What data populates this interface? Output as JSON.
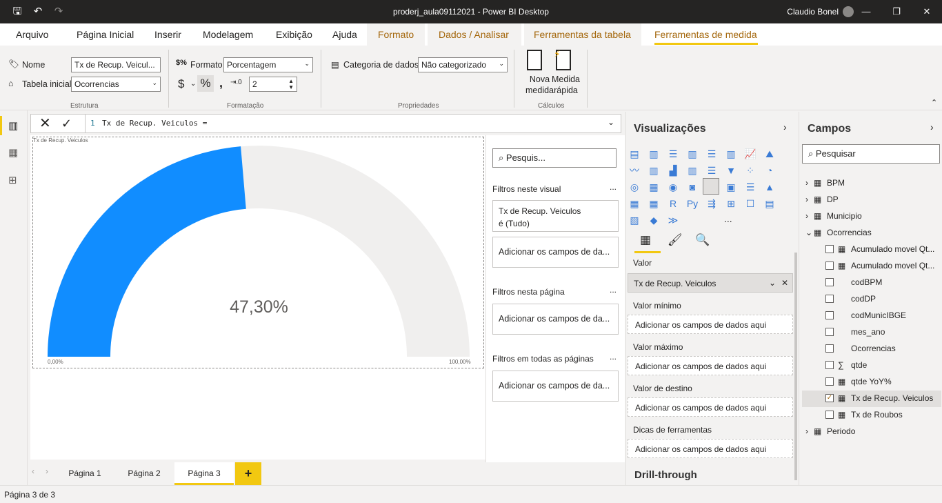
{
  "window": {
    "title": "proderj_aula09112021 - Power BI Desktop",
    "user": "Claudio Bonel"
  },
  "tabs": [
    "Arquivo",
    "Página Inicial",
    "Inserir",
    "Modelagem",
    "Exibição",
    "Ajuda",
    "Formato",
    "Dados / Analisar",
    "Ferramentas da tabela",
    "Ferramentas de medida"
  ],
  "ribbon": {
    "nome_label": "Nome",
    "nome_value": "Tx de Recup. Veicul...",
    "tabela_label": "Tabela inicial",
    "tabela_value": "Ocorrencias",
    "formato_label": "Formato",
    "formato_value": "Porcentagem",
    "currency": "$",
    "percent": "%",
    "comma": ",",
    "decimals": "2",
    "categoria_label": "Categoria de dados",
    "categoria_value": "Não categorizado",
    "nova_medida": [
      "Nova",
      "medida"
    ],
    "medida_rapida": [
      "Medida",
      "rápida"
    ],
    "groups": [
      "Estrutura",
      "Formatação",
      "Propriedades",
      "Cálculos"
    ]
  },
  "formula": {
    "line": "1",
    "text": "Tx de Recup. Veiculos ="
  },
  "visual": {
    "title": "Tx de Recup. Veiculos",
    "value_label": "47,30%",
    "min_label": "0,00%",
    "max_label": "100,00%"
  },
  "chart_data": {
    "type": "gauge",
    "value": 47.3,
    "min": 0,
    "max": 100,
    "unit": "%",
    "fill_color": "#118dff",
    "track_color": "#f0efee"
  },
  "filters": {
    "search": "Pesquis...",
    "visual_hdr": "Filtros neste visual",
    "applied": [
      "Tx de Recup. Veiculos",
      "é (Tudo)"
    ],
    "add": "Adicionar os campos de da...",
    "page_hdr": "Filtros nesta página",
    "all_hdr": "Filtros em todas as páginas",
    "dots": "..."
  },
  "viz": {
    "title": "Visualizações",
    "valor": "Valor",
    "valor_field": "Tx de Recup. Veiculos",
    "wells": [
      "Valor mínimo",
      "Valor máximo",
      "Valor de destino",
      "Dicas de ferramentas"
    ],
    "add": "Adicionar os campos de dados aqui",
    "drill": "Drill-through",
    "more": "..."
  },
  "campos": {
    "title": "Campos",
    "search": "Pesquisar",
    "tables": [
      "BPM",
      "DP",
      "Municipio",
      "Ocorrencias",
      "Periodo"
    ],
    "fields": [
      "Acumulado movel Qt...",
      "Acumulado movel Qt...",
      "codBPM",
      "codDP",
      "codMunicIBGE",
      "mes_ano",
      "Ocorrencias",
      "qtde",
      "qtde YoY%",
      "Tx de Recup. Veiculos",
      "Tx de Roubos"
    ]
  },
  "pages": [
    "Página 1",
    "Página 2",
    "Página 3"
  ],
  "add_page": "+",
  "status": "Página 3 de 3"
}
